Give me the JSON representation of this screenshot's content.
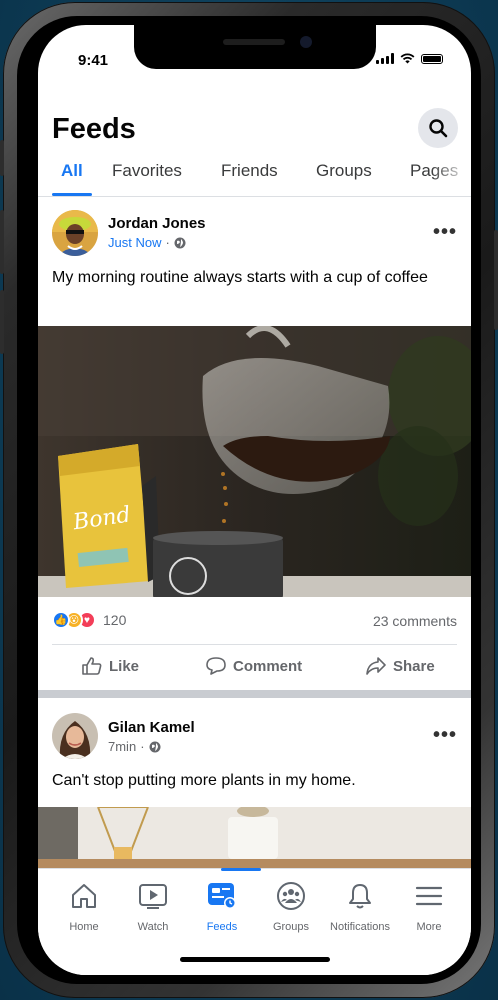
{
  "status": {
    "time": "9:41"
  },
  "header": {
    "title": "Feeds"
  },
  "tabs": [
    {
      "label": "All",
      "active": true
    },
    {
      "label": "Favorites",
      "active": false
    },
    {
      "label": "Friends",
      "active": false
    },
    {
      "label": "Groups",
      "active": false
    },
    {
      "label": "Pages",
      "active": false
    }
  ],
  "posts": [
    {
      "author": "Jordan Jones",
      "time": "Just Now",
      "meta_sep": "·",
      "text": "My morning routine always starts with a cup of coffee",
      "reaction_count": "120",
      "comments": "23 comments"
    },
    {
      "author": "Gilan Kamel",
      "time": "7min",
      "meta_sep": "·",
      "text": "Can't stop putting more plants in my home."
    }
  ],
  "actions": {
    "like": "Like",
    "comment": "Comment",
    "share": "Share"
  },
  "tabbar": [
    {
      "label": "Home",
      "icon": "home-icon"
    },
    {
      "label": "Watch",
      "icon": "watch-icon"
    },
    {
      "label": "Feeds",
      "icon": "feeds-icon",
      "active": true
    },
    {
      "label": "Groups",
      "icon": "groups-icon"
    },
    {
      "label": "Notifications",
      "icon": "bell-icon"
    },
    {
      "label": "More",
      "icon": "menu-icon"
    }
  ],
  "colors": {
    "accent": "#1877f2",
    "background": "#0d3d57",
    "secondary_text": "#65676b"
  }
}
